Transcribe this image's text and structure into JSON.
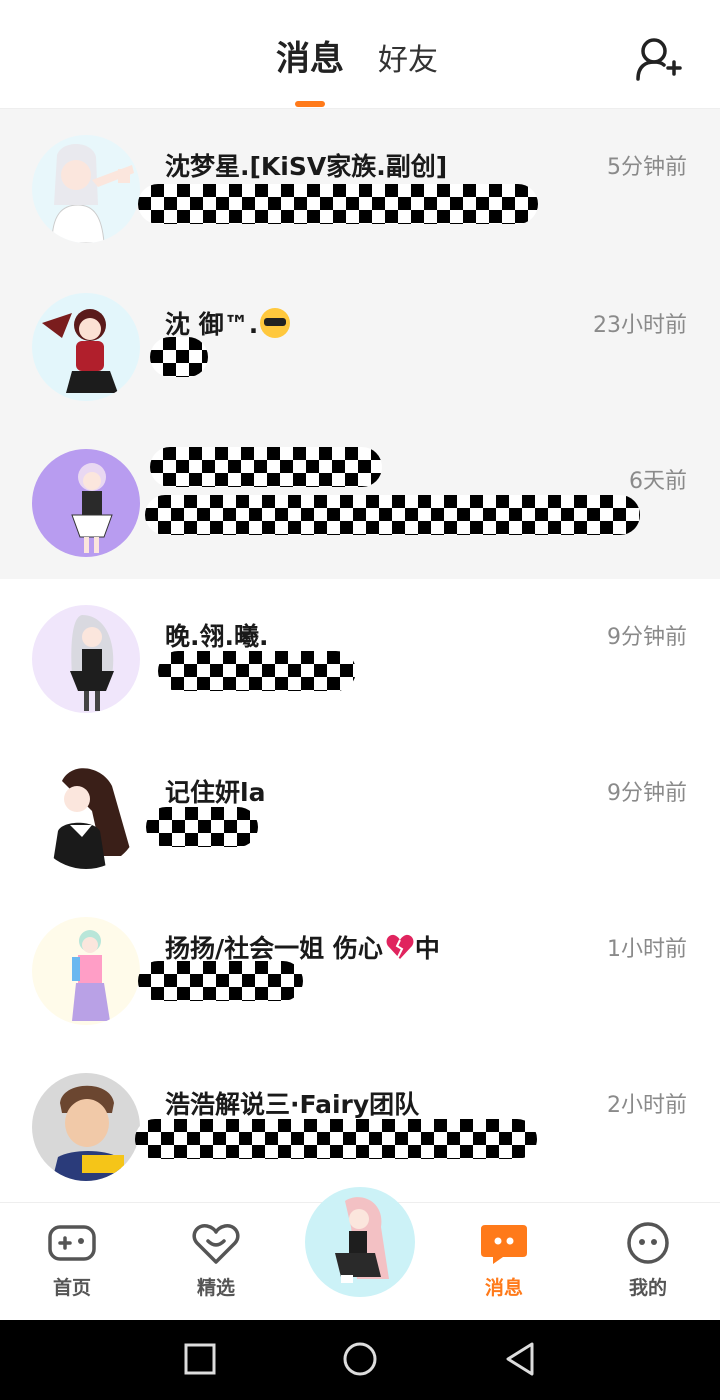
{
  "header": {
    "tab_messages": "消息",
    "tab_friends": "好友",
    "add_friend_icon": "person-add-icon",
    "accent": "#ff7a1a"
  },
  "messages": [
    {
      "name": "沈梦星.[KiSV家族.副创]",
      "time": "5分钟前",
      "preview": "redacted"
    },
    {
      "name": "沈 御™.",
      "name_emoji": "sunglasses-emoji",
      "time": "23小时前",
      "preview": "redacted"
    },
    {
      "name": "redacted",
      "time": "6天前",
      "preview": "redacted"
    },
    {
      "name": "晚.翎.曦.",
      "time": "9分钟前",
      "preview": "redacted"
    },
    {
      "name": "记住妍la",
      "time": "9分钟前",
      "preview": "redacted"
    },
    {
      "name": "扬扬/社会一姐 伤心",
      "name_emoji": "broken-heart-emoji",
      "name_suffix": "中",
      "time": "1小时前",
      "preview": "redacted"
    },
    {
      "name": "浩浩解说三·Fairy团队",
      "time": "2小时前",
      "preview": "redacted"
    }
  ],
  "bottom_nav": {
    "home": "首页",
    "featured": "精选",
    "messages": "消息",
    "profile": "我的",
    "active": "消息"
  },
  "system_nav": {
    "recents_icon": "square-icon",
    "home_icon": "circle-icon",
    "back_icon": "triangle-back-icon"
  }
}
